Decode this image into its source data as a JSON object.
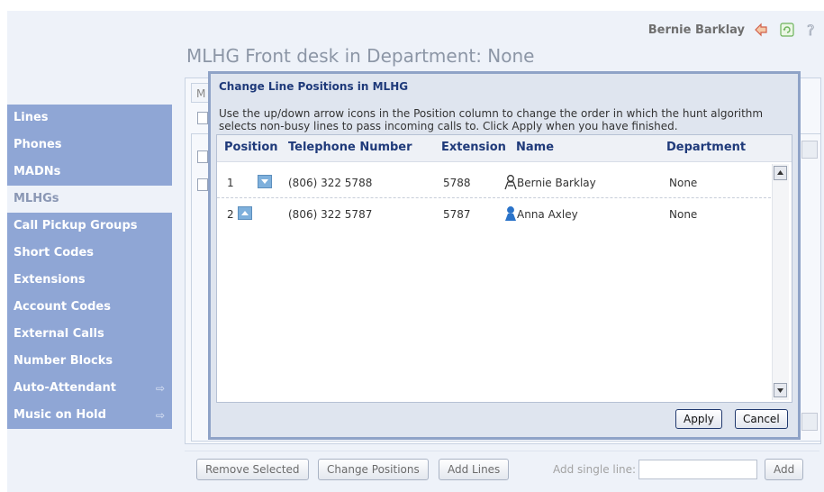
{
  "header": {
    "user_name": "Bernie Barklay",
    "page_title": "MLHG Front desk in Department: None",
    "tab_partial": "M"
  },
  "sidebar": {
    "items": [
      {
        "label": "Lines",
        "active": false,
        "has_arrow": false
      },
      {
        "label": "Phones",
        "active": false,
        "has_arrow": false
      },
      {
        "label": "MADNs",
        "active": false,
        "has_arrow": false
      },
      {
        "label": "MLHGs",
        "active": true,
        "has_arrow": false
      },
      {
        "label": "Call Pickup Groups",
        "active": false,
        "has_arrow": false
      },
      {
        "label": "Short Codes",
        "active": false,
        "has_arrow": false
      },
      {
        "label": "Extensions",
        "active": false,
        "has_arrow": false
      },
      {
        "label": "Account Codes",
        "active": false,
        "has_arrow": false
      },
      {
        "label": "External Calls",
        "active": false,
        "has_arrow": false
      },
      {
        "label": "Number Blocks",
        "active": false,
        "has_arrow": false
      },
      {
        "label": "Auto-Attendant",
        "active": false,
        "has_arrow": true
      },
      {
        "label": "Music on Hold",
        "active": false,
        "has_arrow": true
      }
    ],
    "arrow_glyph": "⇨"
  },
  "toolbar": {
    "remove_selected": "Remove Selected",
    "change_positions": "Change Positions",
    "add_lines": "Add Lines",
    "add_single_line_label": "Add single line:",
    "add_single_line_value": "",
    "add": "Add"
  },
  "dialog": {
    "title": "Change Line Positions in MLHG",
    "description": "Use the up/down arrow icons in the Position column to change the order in which the hunt algorithm selects non-busy lines to pass incoming calls to. Click Apply when you have finished.",
    "columns": {
      "position": "Position",
      "telephone_number": "Telephone Number",
      "extension": "Extension",
      "name": "Name",
      "department": "Department"
    },
    "rows": [
      {
        "position": "1",
        "arrow": "down",
        "telephone": "(806) 322 5788",
        "extension": "5788",
        "name": "Bernie Barklay",
        "department": "None",
        "person_color": "#333333"
      },
      {
        "position": "2",
        "arrow": "up",
        "telephone": "(806) 322 5787",
        "extension": "5787",
        "name": "Anna Axley",
        "department": "None",
        "person_color": "#2a73c9"
      }
    ],
    "apply": "Apply",
    "cancel": "Cancel"
  },
  "colors": {
    "sidebar_bg": "#8fa6d5",
    "header_blue": "#1f3a7a",
    "dialog_border": "#8fa3c7"
  }
}
